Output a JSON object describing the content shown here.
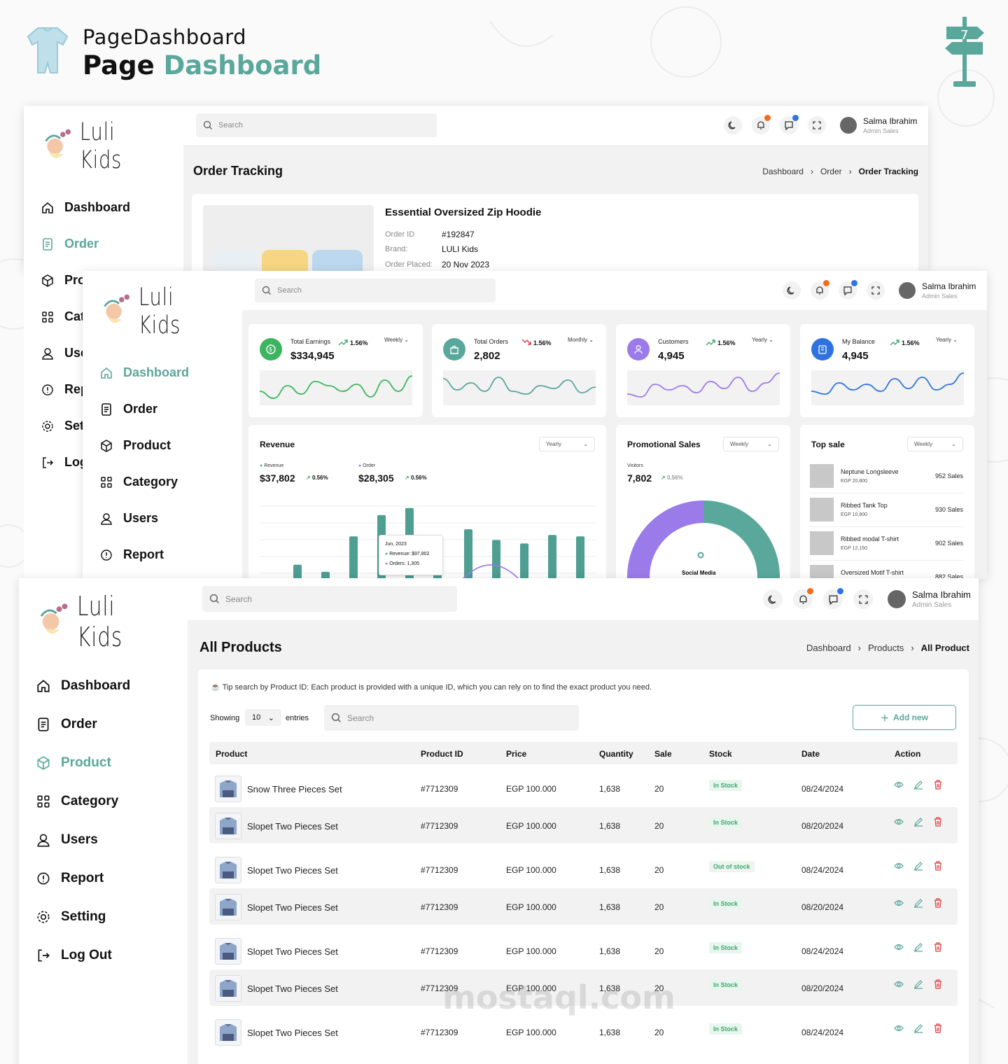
{
  "header": {
    "title": "PageDashboard",
    "subtitle_a": "Page",
    "subtitle_b": "Dashboard",
    "sign_number": "7"
  },
  "brand": {
    "name": "Luli Kids",
    "accent": "#5aa79b"
  },
  "topbar": {
    "search_placeholder": "Search",
    "user_name": "Salma Ibrahim",
    "user_role": "Admin Sales"
  },
  "nav": {
    "dashboard": "Dashboard",
    "order": "Order",
    "product": "Product",
    "category": "Category",
    "users": "Users",
    "report": "Report",
    "setting": "Setting",
    "logout": "Log Out"
  },
  "nav_partial": {
    "product": "Pro",
    "category": "Cat",
    "users": "Use",
    "report": "Rep",
    "setting": "Set",
    "logout": "Log"
  },
  "order_tracking": {
    "title": "Order Tracking",
    "breadcrumb": [
      "Dashboard",
      "Order",
      "Order Tracking"
    ],
    "product_name": "Essential Oversized Zip Hoodie",
    "order_id_label": "Order ID",
    "order_id": "#192847",
    "brand_label": "Brand:",
    "brand": "LULI Kids",
    "placed_label": "Order Placed:",
    "placed": "20 Nov 2023"
  },
  "stats": [
    {
      "label": "Total Earnings",
      "pct": "1.56%",
      "value": "$334,945",
      "period": "Weekly",
      "trend": "up",
      "icon": "dollar-icon",
      "color": "#3cb55e",
      "spark": [
        30,
        40,
        22,
        34,
        16,
        22,
        30,
        20,
        38,
        14,
        30,
        8
      ]
    },
    {
      "label": "Total Orders",
      "pct": "1.56%",
      "value": "2,802",
      "period": "Monthly",
      "trend": "down",
      "icon": "bag-icon",
      "color": "#5aa79b",
      "spark": [
        12,
        28,
        18,
        30,
        10,
        30,
        34,
        22,
        26,
        14,
        32,
        24
      ]
    },
    {
      "label": "Customers",
      "pct": "1.56%",
      "value": "4,945",
      "period": "Yearly",
      "trend": "up",
      "icon": "user-icon",
      "color": "#9b7be9",
      "spark": [
        34,
        38,
        20,
        28,
        22,
        32,
        16,
        26,
        10,
        30,
        18,
        4
      ]
    },
    {
      "label": "My Balance",
      "pct": "1.56%",
      "value": "4,945",
      "period": "Yearly",
      "trend": "up",
      "icon": "wallet-icon",
      "color": "#2f73e0",
      "spark": [
        30,
        34,
        18,
        28,
        20,
        30,
        12,
        26,
        10,
        28,
        20,
        4
      ]
    }
  ],
  "revenue": {
    "title": "Revenue",
    "period": "Yearly",
    "rev_label": "Revenue",
    "rev_value": "$37,802",
    "rev_pct": "0.56%",
    "ord_label": "Order",
    "ord_value": "$28,305",
    "ord_pct": "0.56%",
    "tooltip_title": "Jun, 2023",
    "tooltip_rev": "Revenue: $97,802",
    "tooltip_ord": "Orders: 1,305"
  },
  "chart_data": {
    "type": "bar",
    "series": [
      {
        "name": "Revenue",
        "values": [
          20,
          10,
          60,
          90,
          100,
          20,
          70,
          55,
          50,
          62,
          60
        ]
      }
    ],
    "title": "Revenue"
  },
  "promo": {
    "title": "Promotional Sales",
    "period": "Weekly",
    "visitors_label": "Visitors",
    "visitors": "7,802",
    "pct": "0.56%",
    "center_label": "Social Media"
  },
  "top_sale": {
    "title": "Top sale",
    "period": "Weekly",
    "items": [
      {
        "name": "Neptune Longsleeve",
        "price": "EGP 20,800",
        "sales": "952 Sales"
      },
      {
        "name": "Ribbed Tank Top",
        "price": "EGP 10,800",
        "sales": "930 Sales"
      },
      {
        "name": "Ribbed modal T-shirt",
        "price": "EGP 12,150",
        "sales": "902 Sales"
      },
      {
        "name": "Oversized Motif T-shirt",
        "price": "",
        "sales": "882 Sales"
      }
    ]
  },
  "products": {
    "title": "All Products",
    "breadcrumb": [
      "Dashboard",
      "Products",
      "All Product"
    ],
    "tip": "Tip search by Product ID: Each product is provided with a unique ID, which you can rely on to find the exact product you need.",
    "showing": "Showing",
    "entries_value": "10",
    "entries": "entries",
    "search_placeholder": "Search",
    "add_new": "Add new",
    "columns": [
      "Product",
      "Product ID",
      "Price",
      "Quantity",
      "Sale",
      "Stock",
      "Date",
      "Action"
    ],
    "rows": [
      {
        "name": "Snow Three Pieces Set",
        "id": "#7712309",
        "price": "EGP 100.000",
        "qty": "1,638",
        "sale": "20",
        "stock": "In Stock",
        "date": "08/24/2024"
      },
      {
        "name": "Slopet Two Pieces Set",
        "id": "#7712309",
        "price": "EGP 100.000",
        "qty": "1,638",
        "sale": "20",
        "stock": "In Stock",
        "date": "08/20/2024"
      },
      {
        "name": "Slopet Two Pieces Set",
        "id": "#7712309",
        "price": "EGP 100.000",
        "qty": "1,638",
        "sale": "20",
        "stock": "Out of stock",
        "date": "08/24/2024"
      },
      {
        "name": "Slopet Two Pieces Set",
        "id": "#7712309",
        "price": "EGP 100.000",
        "qty": "1,638",
        "sale": "20",
        "stock": "In Stock",
        "date": "08/20/2024"
      },
      {
        "name": "Slopet Two Pieces Set",
        "id": "#7712309",
        "price": "EGP 100.000",
        "qty": "1,638",
        "sale": "20",
        "stock": "In Stock",
        "date": "08/24/2024"
      },
      {
        "name": "Slopet Two Pieces Set",
        "id": "#7712309",
        "price": "EGP 100.000",
        "qty": "1,638",
        "sale": "20",
        "stock": "In Stock",
        "date": "08/20/2024"
      },
      {
        "name": "Slopet Two Pieces Set",
        "id": "#7712309",
        "price": "EGP 100.000",
        "qty": "1,638",
        "sale": "20",
        "stock": "In Stock",
        "date": "08/24/2024"
      }
    ]
  },
  "watermark": {
    "text": "mostaql.com"
  }
}
